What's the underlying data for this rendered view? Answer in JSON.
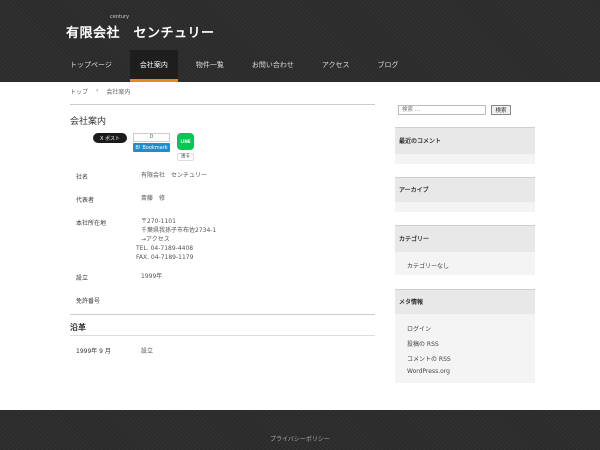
{
  "header": {
    "site_title": "有限会社　センチュリー",
    "site_subtitle": "century",
    "nav": [
      {
        "label": "トップページ"
      },
      {
        "label": "会社案内"
      },
      {
        "label": "物件一覧"
      },
      {
        "label": "お問い合わせ"
      },
      {
        "label": "アクセス"
      },
      {
        "label": "ブログ"
      }
    ],
    "active_tab": "会社案内"
  },
  "breadcrumb": [
    "トップ",
    "›",
    "会社案内"
  ],
  "main": {
    "page_title": "会社案内",
    "social": {
      "tweet_label": "X ポスト",
      "hatena_count": "0",
      "hatena_label": "B! Bookmark",
      "line_icon_text": "LINE",
      "line_label": "送る"
    },
    "info": [
      {
        "label": "社名",
        "lines": [
          "有限会社　センチュリー"
        ]
      },
      {
        "label": "代表者",
        "lines": [
          "斎藤　修"
        ]
      },
      {
        "label": "本社所在地",
        "lines": [
          "〒270-1101",
          "千葉県我孫子市布佐2734-1",
          "→アクセス",
          "TEL. 04-7189-4408",
          "FAX. 04-7189-1179"
        ]
      },
      {
        "label": "設立",
        "lines": [
          "1999年"
        ]
      },
      {
        "label": "免許番号",
        "lines": [
          ""
        ]
      }
    ],
    "history_heading": "沿革",
    "history": [
      {
        "date": "1999年 9 月",
        "event": "設立"
      }
    ]
  },
  "sidebar": {
    "search_placeholder": "検索 …",
    "search_button": "検索",
    "recent_comments": "最近のコメント",
    "archives": "アーカイブ",
    "categories": "カテゴリー",
    "no_categories": "カテゴリーなし",
    "meta": "メタ情報",
    "meta_links": [
      "ログイン",
      "投稿の RSS",
      "コメントの RSS",
      "WordPress.org"
    ]
  },
  "footer": {
    "privacy": "プライバシーポリシー"
  }
}
